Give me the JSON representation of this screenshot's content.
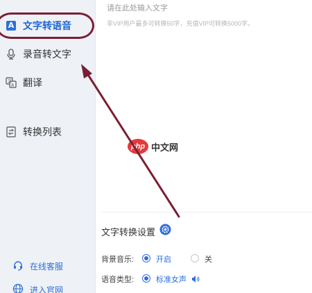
{
  "sidebar": {
    "items": [
      {
        "label": "文字转语音",
        "icon": "letter-a-icon"
      },
      {
        "label": "录音转文字",
        "icon": "microphone-icon"
      },
      {
        "label": "翻译",
        "icon": "translate-icon"
      },
      {
        "label": "转换列表",
        "icon": "transfer-list-icon"
      }
    ],
    "active_index": 0,
    "bottom_links": [
      {
        "label": "在线客服",
        "icon": "headset-icon"
      },
      {
        "label": "进入官网",
        "icon": "globe-icon"
      }
    ]
  },
  "editor": {
    "placeholder": "请在此处输入文字",
    "limit_hint": "非VIP用户最多可转换50字，充值VIP可转换5000字。"
  },
  "settings": {
    "title": "文字转换设置",
    "background_music": {
      "label": "背景音乐:",
      "options": [
        {
          "label": "开启",
          "selected": true
        },
        {
          "label": "关",
          "selected": false
        }
      ]
    },
    "voice_type": {
      "label": "语音类型:",
      "selected_label": "标准女声",
      "icon": "speaker-icon"
    }
  },
  "watermark": {
    "badge": "php",
    "text": "中文网"
  },
  "colors": {
    "accent": "#2d6fd8",
    "annotation": "#7a1f33",
    "sidebar_bg": "#eef1f6"
  }
}
